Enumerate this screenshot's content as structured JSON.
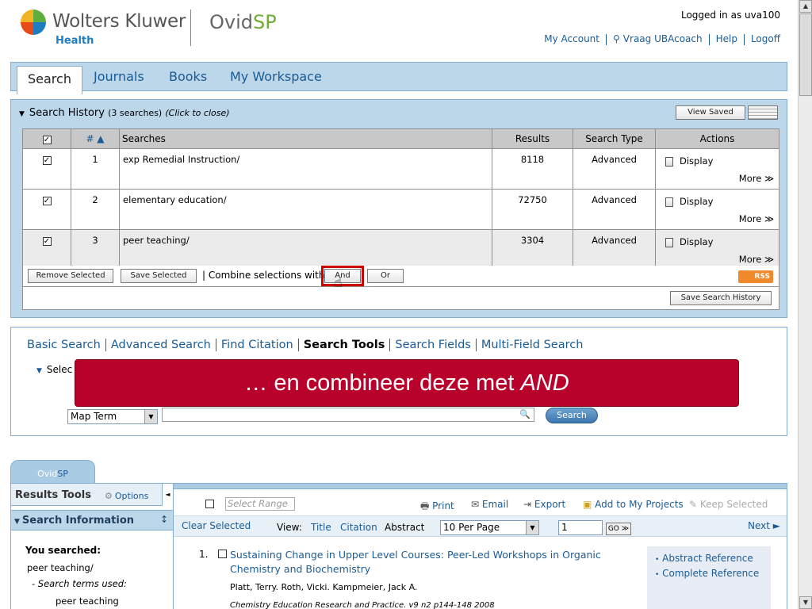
{
  "header": {
    "brand_name": "Wolters Kluwer",
    "brand_sub": "Health",
    "product_prefix": "Ovid",
    "product_suffix": "SP",
    "logged_in": "Logged in as uva100",
    "links": [
      "My Account",
      "Vraag UBAcoach",
      "Help",
      "Logoff"
    ]
  },
  "nav": {
    "tabs": [
      "Search",
      "Journals",
      "Books",
      "My Workspace"
    ],
    "active": "Search"
  },
  "history": {
    "title": "Search History",
    "count": "(3 searches)",
    "hint": "(Click to close)",
    "view_saved": "View Saved",
    "columns": [
      "# ▲",
      "Searches",
      "Results",
      "Search Type",
      "Actions"
    ],
    "rows": [
      {
        "num": "1",
        "search": "exp Remedial Instruction/",
        "results": "8118",
        "type": "Advanced",
        "checked": true
      },
      {
        "num": "2",
        "search": "elementary education/",
        "results": "72750",
        "type": "Advanced",
        "checked": true
      },
      {
        "num": "3",
        "search": "peer teaching/",
        "results": "3304",
        "type": "Advanced",
        "checked": true
      }
    ],
    "display_label": "Display",
    "more_label": "More ≫",
    "remove_selected": "Remove Selected",
    "save_selected": "Save Selected",
    "combine_label": "| Combine selections with:",
    "and_label": "And",
    "or_label": "Or",
    "rss_label": "RSS",
    "save_history": "Save Search History"
  },
  "search_panel": {
    "tabs": [
      "Basic Search",
      "Advanced Search",
      "Find Citation",
      "Search Tools",
      "Search Fields",
      "Multi-Field Search"
    ],
    "current_tab": "Search Tools",
    "select_label": "Selec",
    "banner_text": "… en combineer deze met",
    "banner_em": "AND",
    "map_term": "Map Term",
    "search_button": "Search"
  },
  "results": {
    "tab_prefix": "Ovid",
    "tab_suffix": "SP",
    "tools_title": "Results Tools",
    "options_label": "Options",
    "info_title": "Search Information",
    "you_searched": "You searched:",
    "query": "peer teaching/",
    "terms_used": "- Search terms used:",
    "term": "peer teaching",
    "select_range_placeholder": "Select Range",
    "print": "Print",
    "email": "Email",
    "export": "Export",
    "add_projects": "Add to My Projects",
    "keep_selected": "Keep Selected",
    "clear_selected": "Clear Selected",
    "view_label": "View:",
    "view_title": "Title",
    "view_citation": "Citation",
    "view_abstract": "Abstract",
    "per_page": "10 Per Page",
    "page_num": "1",
    "go": "GO ≫",
    "next": "Next ►",
    "item_num": "1.",
    "item_title": "Sustaining Change in Upper Level Courses: Peer-Led Workshops in Organic Chemistry and Biochemistry",
    "item_authors": "Platt, Terry. Roth, Vicki. Kampmeier, Jack A.",
    "item_source": "Chemistry Education Research and Practice. v9 n2 p144-148 2008",
    "abstract_ref": "Abstract Reference",
    "complete_ref": "Complete Reference"
  },
  "colors": {
    "nav_blue": "#bcd6ea",
    "link_blue": "#1a5b96",
    "banner_red": "#b8022b",
    "highlight_red": "#d10000"
  }
}
